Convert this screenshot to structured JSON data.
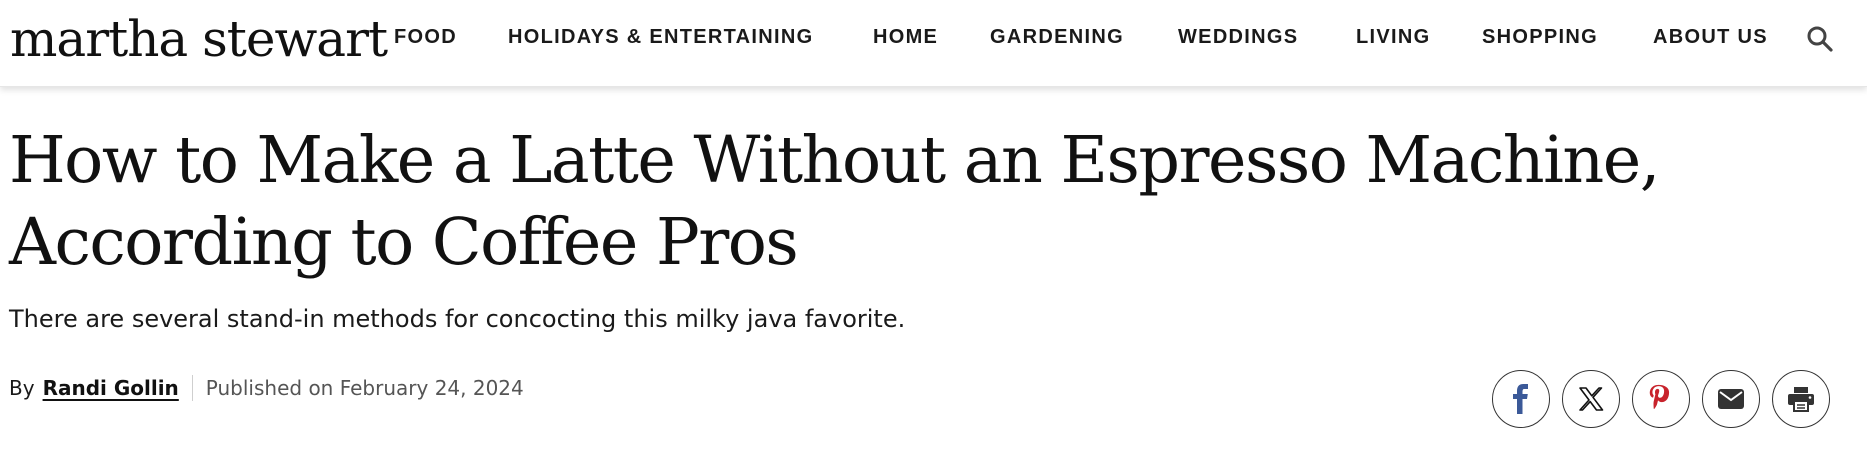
{
  "header": {
    "logo": "martha stewart",
    "nav": [
      {
        "label": "FOOD"
      },
      {
        "label": "HOLIDAYS & ENTERTAINING"
      },
      {
        "label": "HOME"
      },
      {
        "label": "GARDENING"
      },
      {
        "label": "WEDDINGS"
      },
      {
        "label": "LIVING"
      },
      {
        "label": "SHOPPING"
      },
      {
        "label": "ABOUT US"
      }
    ],
    "search_icon": "search-icon"
  },
  "article": {
    "headline": "How to Make a Latte Without an Espresso Machine, According to Coffee Pros",
    "dek": "There are several stand-in methods for concocting this milky java favorite.",
    "byline": {
      "prefix": "By",
      "author": "Randi Gollin",
      "published": "Published on February 24, 2024"
    }
  },
  "share": {
    "buttons": [
      {
        "icon": "facebook-icon",
        "color": "#3b5998"
      },
      {
        "icon": "x-icon",
        "color": "#111111"
      },
      {
        "icon": "pinterest-icon",
        "color": "#c8232c"
      },
      {
        "icon": "email-icon",
        "color": "#333333"
      },
      {
        "icon": "print-icon",
        "color": "#333333"
      }
    ]
  }
}
